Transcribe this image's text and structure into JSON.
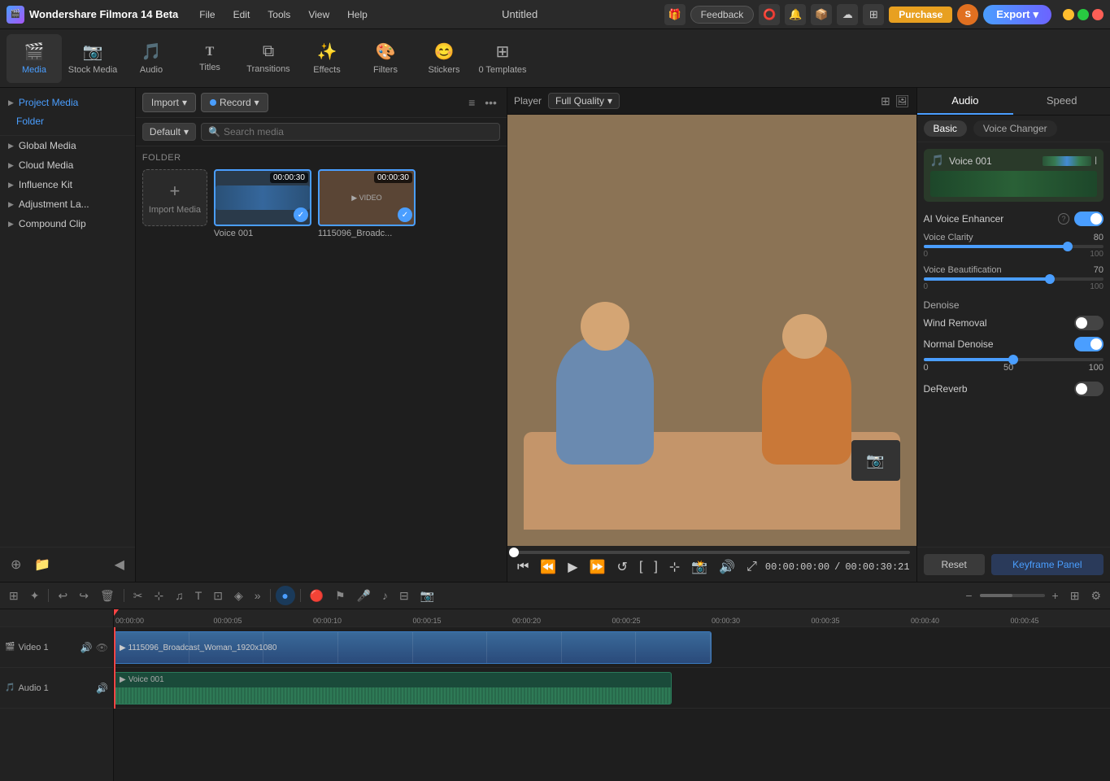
{
  "app": {
    "title": "Wondershare Filmora 14 Beta",
    "window_title": "Untitled",
    "logo_text": "F"
  },
  "titlebar": {
    "menu": [
      "File",
      "Edit",
      "Tools",
      "View",
      "Help"
    ],
    "feedback_label": "Feedback",
    "purchase_label": "Purchase",
    "export_label": "Export",
    "avatar_text": "S"
  },
  "toolbar": {
    "items": [
      {
        "id": "media",
        "label": "Media",
        "icon": "🎬",
        "active": true
      },
      {
        "id": "stock-media",
        "label": "Stock Media",
        "icon": "📷"
      },
      {
        "id": "audio",
        "label": "Audio",
        "icon": "🎵"
      },
      {
        "id": "titles",
        "label": "Titles",
        "icon": "T"
      },
      {
        "id": "transitions",
        "label": "Transitions",
        "icon": "✦"
      },
      {
        "id": "effects",
        "label": "Effects",
        "icon": "✨"
      },
      {
        "id": "filters",
        "label": "Filters",
        "icon": "🎨"
      },
      {
        "id": "stickers",
        "label": "Stickers",
        "icon": "😊"
      },
      {
        "id": "templates",
        "label": "0 Templates",
        "icon": "⊞"
      }
    ]
  },
  "left_panel": {
    "sections": [
      {
        "id": "project-media",
        "label": "Project Media",
        "active": true
      },
      {
        "id": "folder",
        "label": "Folder",
        "type": "sub"
      },
      {
        "id": "global-media",
        "label": "Global Media"
      },
      {
        "id": "cloud-media",
        "label": "Cloud Media"
      },
      {
        "id": "influence-kit",
        "label": "Influence Kit"
      },
      {
        "id": "adjustment-la",
        "label": "Adjustment La..."
      },
      {
        "id": "compound-clip",
        "label": "Compound Clip"
      }
    ]
  },
  "media_panel": {
    "import_label": "Import",
    "record_label": "Record",
    "default_label": "Default",
    "search_placeholder": "Search media",
    "folder_label": "FOLDER",
    "import_media_label": "Import Media",
    "media_items": [
      {
        "id": "voice-001",
        "name": "Voice 001",
        "duration": "00:00:30",
        "type": "audio",
        "checked": true
      },
      {
        "id": "broadcast",
        "name": "1115096_Broadc...",
        "duration": "00:00:30",
        "type": "video",
        "checked": true
      }
    ]
  },
  "preview": {
    "player_label": "Player",
    "quality_label": "Full Quality",
    "current_time": "00:00:00:00",
    "total_time": "00:00:30:21",
    "progress_pct": 0
  },
  "right_panel": {
    "tabs": [
      "Audio",
      "Speed"
    ],
    "active_tab": "Audio",
    "sub_tabs": [
      "Basic",
      "Voice Changer"
    ],
    "active_sub_tab": "Basic",
    "voice_name": "Voice 001",
    "ai_voice_enhancer_label": "AI Voice Enhancer",
    "ai_voice_enhancer_on": true,
    "voice_clarity_label": "Voice Clarity",
    "voice_clarity_value": 80,
    "voice_clarity_min": 0,
    "voice_clarity_max": 100,
    "voice_beautification_label": "Voice Beautification",
    "voice_beautification_value": 70,
    "voice_beautification_min": 0,
    "voice_beautification_max": 100,
    "denoise_label": "Denoise",
    "wind_removal_label": "Wind Removal",
    "wind_removal_on": false,
    "normal_denoise_label": "Normal Denoise",
    "normal_denoise_on": true,
    "normal_denoise_value": 50,
    "normal_denoise_min": 0,
    "normal_denoise_max": 100,
    "dereverb_label": "DeReverb",
    "dereverb_on": false,
    "reset_label": "Reset",
    "keyframe_panel_label": "Keyframe Panel"
  },
  "timeline": {
    "ruler_marks": [
      "00:00:00",
      "00:00:05",
      "00:00:10",
      "00:00:15",
      "00:00:20",
      "00:00:25",
      "00:00:30",
      "00:00:35",
      "00:00:40",
      "00:00:45"
    ],
    "tracks": [
      {
        "id": "video-1",
        "label": "Video 1",
        "type": "video",
        "clips": [
          {
            "label": "1115096_Broadcast_Woman_1920x1080",
            "start_pct": 0,
            "width_pct": 60
          }
        ]
      },
      {
        "id": "audio-1",
        "label": "Audio 1",
        "type": "audio",
        "clips": [
          {
            "label": "Voice 001",
            "start_pct": 0,
            "width_pct": 56
          }
        ]
      }
    ]
  }
}
